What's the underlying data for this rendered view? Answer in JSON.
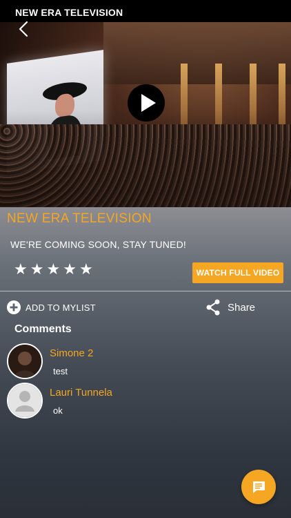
{
  "header": {
    "title": "NEW ERA TELEVISION"
  },
  "icons": {
    "back": "chevron-left-icon",
    "play": "play-icon",
    "add": "plus-circle-icon",
    "share": "share-icon",
    "chat": "chat-icon",
    "star": "star-icon",
    "avatar_placeholder": "user-placeholder-icon"
  },
  "show": {
    "title": "NEW ERA TELEVISION",
    "tagline": "WE'RE COMING SOON, STAY TUNED!",
    "rating_stars": [
      "★",
      "★",
      "★",
      "★",
      "★"
    ],
    "watch_button": "WATCH FULL VIDEO"
  },
  "actions": {
    "add_to_mylist": "ADD TO MYLIST",
    "share": "Share"
  },
  "comments": {
    "title": "Comments",
    "items": [
      {
        "name": "Simone 2",
        "text": "test"
      },
      {
        "name": "Lauri Tunnela",
        "text": "ok"
      }
    ]
  },
  "colors": {
    "accent": "#f5a623",
    "text": "#ffffff",
    "topbar": "#000000"
  }
}
